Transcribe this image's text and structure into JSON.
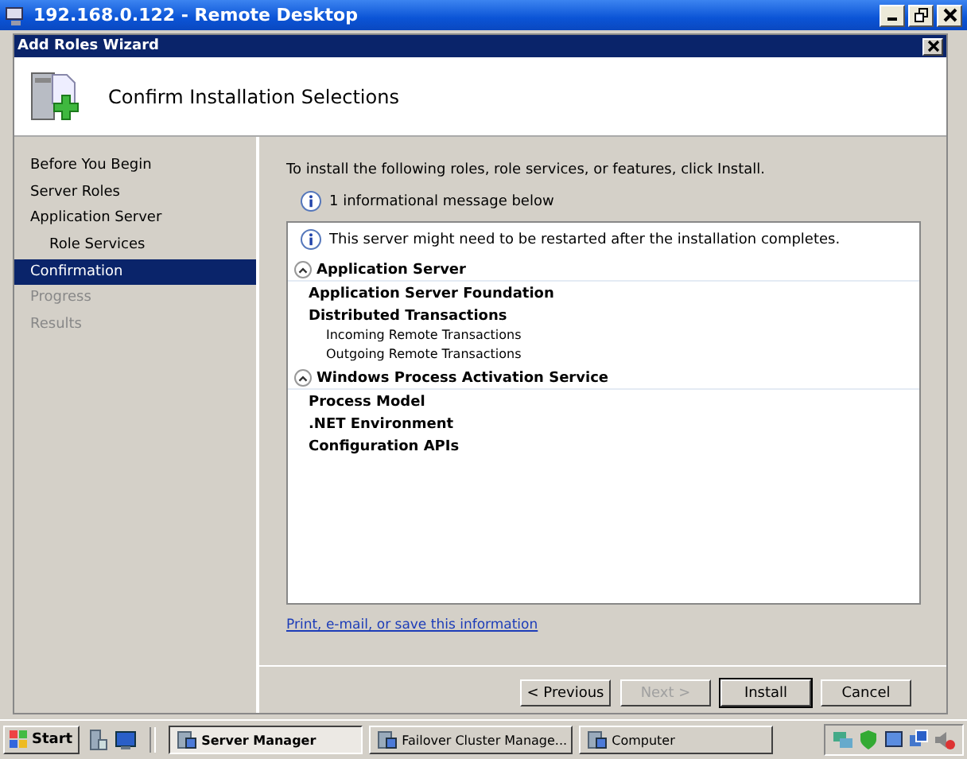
{
  "remote_window": {
    "title": "192.168.0.122 - Remote Desktop"
  },
  "wizard": {
    "title": "Add Roles Wizard",
    "heading": "Confirm Installation Selections"
  },
  "nav": [
    {
      "label": "Before You Begin",
      "selected": false,
      "disabled": false
    },
    {
      "label": "Server Roles",
      "selected": false,
      "disabled": false
    },
    {
      "label": "Application Server",
      "selected": false,
      "disabled": false,
      "children": [
        {
          "label": "Role Services",
          "selected": false,
          "disabled": false
        }
      ]
    },
    {
      "label": "Confirmation",
      "selected": true,
      "disabled": false
    },
    {
      "label": "Progress",
      "selected": false,
      "disabled": true
    },
    {
      "label": "Results",
      "selected": false,
      "disabled": true
    }
  ],
  "intro": "To install the following roles, role services, or features, click Install.",
  "info_summary": "1 informational message below",
  "summary": {
    "message": "This server might need to be restarted after the installation completes.",
    "sections": [
      {
        "title": "Application Server",
        "expanded": true,
        "items": [
          {
            "label": "Application Server Foundation"
          },
          {
            "label": "Distributed Transactions",
            "children": [
              {
                "label": "Incoming Remote Transactions"
              },
              {
                "label": "Outgoing Remote Transactions"
              }
            ]
          }
        ]
      },
      {
        "title": "Windows Process Activation Service",
        "expanded": true,
        "items": [
          {
            "label": "Process Model"
          },
          {
            "label": ".NET Environment"
          },
          {
            "label": "Configuration APIs"
          }
        ]
      }
    ]
  },
  "link": "Print, e-mail, or save this information",
  "buttons": [
    {
      "label": "< Previous",
      "disabled": false,
      "default": false
    },
    {
      "label": "Next >",
      "disabled": true,
      "default": false
    },
    {
      "label": "Install",
      "disabled": false,
      "default": true
    },
    {
      "label": "Cancel",
      "disabled": false,
      "default": false
    }
  ],
  "taskbar": {
    "start": "Start",
    "tasks": [
      {
        "label": "Server Manager",
        "selected": true
      },
      {
        "label": "Failover Cluster Manage...",
        "selected": false
      },
      {
        "label": "Computer",
        "selected": false
      }
    ]
  }
}
